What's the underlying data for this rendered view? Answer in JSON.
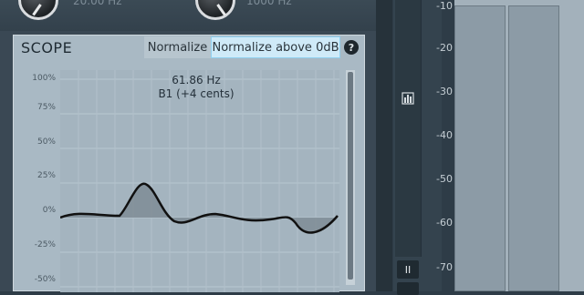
{
  "knobs": {
    "left_value": "20.00 Hz",
    "right_value": "1000 Hz"
  },
  "scope": {
    "title": "SCOPE",
    "normalize_label": "Normalize",
    "normalize_above_label": "Normalize above 0dB",
    "help_label": "?",
    "readout_freq": "61.86 Hz",
    "readout_note": "B1 (+4 cents)",
    "y_labels": [
      "100%",
      "75%",
      "50%",
      "25%",
      "0%",
      "-25%",
      "-50%"
    ],
    "colors": {
      "highlight": "#cfeaf8",
      "curve": "#111111",
      "fill": "#7f8c95"
    }
  },
  "meter_side": {
    "meter_icon": "bar-chart-icon",
    "pause_icon": "pause-icon",
    "pause_label": "II"
  },
  "db_scale": [
    "-10",
    "-20",
    "-30",
    "-40",
    "-50",
    "-60",
    "-70"
  ]
}
